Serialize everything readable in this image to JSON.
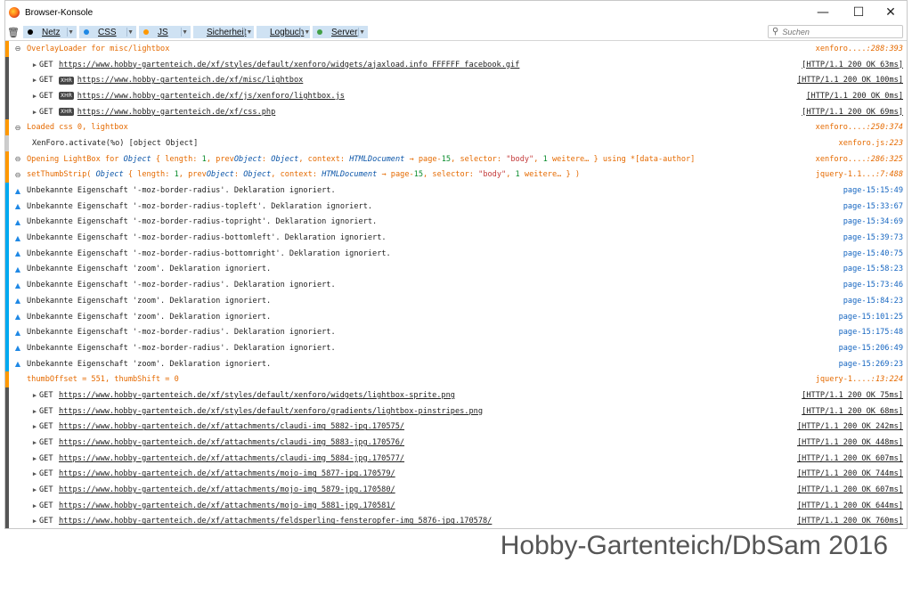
{
  "window": {
    "title": "Browser-Konsole",
    "controls": {
      "minimize": "—",
      "maximize": "☐",
      "close": "✕"
    }
  },
  "toolbar": {
    "filters": [
      {
        "label": "Netz",
        "color": "#000000"
      },
      {
        "label": "CSS",
        "color": "#1e88e5"
      },
      {
        "label": "JS",
        "color": "#ff9800"
      },
      {
        "label": "Sicherheit",
        "color": "#e53935"
      },
      {
        "label": "Logbuch",
        "color": "#9e9e9e"
      },
      {
        "label": "Server",
        "color": "#43a047"
      }
    ],
    "search_placeholder": "Suchen"
  },
  "log": [
    {
      "kind": "js",
      "text": "OverlayLoader for misc/lightbox",
      "file": "xenforo....",
      "pos": ":288:393"
    },
    {
      "kind": "net",
      "method": "GET",
      "xhr": false,
      "url": "https://www.hobby-gartenteich.de/xf/styles/default/xenforo/widgets/ajaxload.info_FFFFFF_facebook.gif",
      "status": "[HTTP/1.1 200 OK 63ms]"
    },
    {
      "kind": "net",
      "method": "GET",
      "xhr": true,
      "url": "https://www.hobby-gartenteich.de/xf/misc/lightbox",
      "status": "[HTTP/1.1 200 OK 100ms]"
    },
    {
      "kind": "net",
      "method": "GET",
      "xhr": true,
      "url": "https://www.hobby-gartenteich.de/xf/js/xenforo/lightbox.js",
      "status": "[HTTP/1.1 200 OK 0ms]"
    },
    {
      "kind": "net",
      "method": "GET",
      "xhr": true,
      "url": "https://www.hobby-gartenteich.de/xf/css.php",
      "status": "[HTTP/1.1 200 OK 69ms]"
    },
    {
      "kind": "js",
      "text": "Loaded css 0, lightbox",
      "file": "xenforo....",
      "pos": ":250:374"
    },
    {
      "kind": "plain",
      "text": "XenForo.activate(%o) [object Object]",
      "file": "xenforo.js",
      "pos": ":223"
    },
    {
      "kind": "js-rich",
      "prefix": "Opening LightBox for ",
      "body": "Object { length: 1, prevObject: Object, context: HTMLDocument → page-15, selector: \"body\", 1 weitere… }  using *[data-author]",
      "file": "xenforo....",
      "pos": ":286:325"
    },
    {
      "kind": "js-rich",
      "prefix": "setThumbStrip( ",
      "body": "Object { length: 1, prevObject: Object, context: HTMLDocument → page-15, selector: \"body\", 1 weitere… } )",
      "file": "jquery-1.1...",
      "pos": ":7:488"
    },
    {
      "kind": "css",
      "text": "Unbekannte Eigenschaft '-moz-border-radius'.  Deklaration ignoriert.",
      "src": "page-15:15:49"
    },
    {
      "kind": "css",
      "text": "Unbekannte Eigenschaft '-moz-border-radius-topleft'.  Deklaration ignoriert.",
      "src": "page-15:33:67"
    },
    {
      "kind": "css",
      "text": "Unbekannte Eigenschaft '-moz-border-radius-topright'.  Deklaration ignoriert.",
      "src": "page-15:34:69"
    },
    {
      "kind": "css",
      "text": "Unbekannte Eigenschaft '-moz-border-radius-bottomleft'.  Deklaration ignoriert.",
      "src": "page-15:39:73"
    },
    {
      "kind": "css",
      "text": "Unbekannte Eigenschaft '-moz-border-radius-bottomright'.  Deklaration ignoriert.",
      "src": "page-15:40:75"
    },
    {
      "kind": "css",
      "text": "Unbekannte Eigenschaft 'zoom'.  Deklaration ignoriert.",
      "src": "page-15:58:23"
    },
    {
      "kind": "css",
      "text": "Unbekannte Eigenschaft '-moz-border-radius'.  Deklaration ignoriert.",
      "src": "page-15:73:46"
    },
    {
      "kind": "css",
      "text": "Unbekannte Eigenschaft 'zoom'.  Deklaration ignoriert.",
      "src": "page-15:84:23"
    },
    {
      "kind": "css",
      "text": "Unbekannte Eigenschaft 'zoom'.  Deklaration ignoriert.",
      "src": "page-15:101:25"
    },
    {
      "kind": "css",
      "text": "Unbekannte Eigenschaft '-moz-border-radius'.  Deklaration ignoriert.",
      "src": "page-15:175:48"
    },
    {
      "kind": "css",
      "text": "Unbekannte Eigenschaft '-moz-border-radius'.  Deklaration ignoriert.",
      "src": "page-15:206:49"
    },
    {
      "kind": "css",
      "text": "Unbekannte Eigenschaft 'zoom'.  Deklaration ignoriert.",
      "src": "page-15:269:23"
    },
    {
      "kind": "js-noicon",
      "text": "thumbOffset = 551, thumbShift = 0",
      "file": "jquery-1....",
      "pos": ":13:224"
    },
    {
      "kind": "net",
      "method": "GET",
      "xhr": false,
      "url": "https://www.hobby-gartenteich.de/xf/styles/default/xenforo/widgets/lightbox-sprite.png",
      "status": "[HTTP/1.1 200 OK 75ms]"
    },
    {
      "kind": "net",
      "method": "GET",
      "xhr": false,
      "url": "https://www.hobby-gartenteich.de/xf/styles/default/xenforo/gradients/lightbox-pinstripes.png",
      "status": "[HTTP/1.1 200 OK 68ms]"
    },
    {
      "kind": "net",
      "method": "GET",
      "xhr": false,
      "url": "https://www.hobby-gartenteich.de/xf/attachments/claudi-img_5882-jpg.170575/",
      "status": "[HTTP/1.1 200 OK 242ms]"
    },
    {
      "kind": "net",
      "method": "GET",
      "xhr": false,
      "url": "https://www.hobby-gartenteich.de/xf/attachments/claudi-img_5883-jpg.170576/",
      "status": "[HTTP/1.1 200 OK 448ms]"
    },
    {
      "kind": "net",
      "method": "GET",
      "xhr": false,
      "url": "https://www.hobby-gartenteich.de/xf/attachments/claudi-img_5884-jpg.170577/",
      "status": "[HTTP/1.1 200 OK 607ms]"
    },
    {
      "kind": "net",
      "method": "GET",
      "xhr": false,
      "url": "https://www.hobby-gartenteich.de/xf/attachments/mojo-img_5877-jpg.170579/",
      "status": "[HTTP/1.1 200 OK 744ms]"
    },
    {
      "kind": "net",
      "method": "GET",
      "xhr": false,
      "url": "https://www.hobby-gartenteich.de/xf/attachments/mojo-img_5879-jpg.170580/",
      "status": "[HTTP/1.1 200 OK 607ms]"
    },
    {
      "kind": "net",
      "method": "GET",
      "xhr": false,
      "url": "https://www.hobby-gartenteich.de/xf/attachments/mojo-img_5881-jpg.170581/",
      "status": "[HTTP/1.1 200 OK 644ms]"
    },
    {
      "kind": "net",
      "method": "GET",
      "xhr": false,
      "url": "https://www.hobby-gartenteich.de/xf/attachments/feldsperling-fensteropfer-img_5876-jpg.170578/",
      "status": "[HTTP/1.1 200 OK 760ms]"
    }
  ],
  "watermark": "Hobby-Gartenteich/DbSam 2016"
}
